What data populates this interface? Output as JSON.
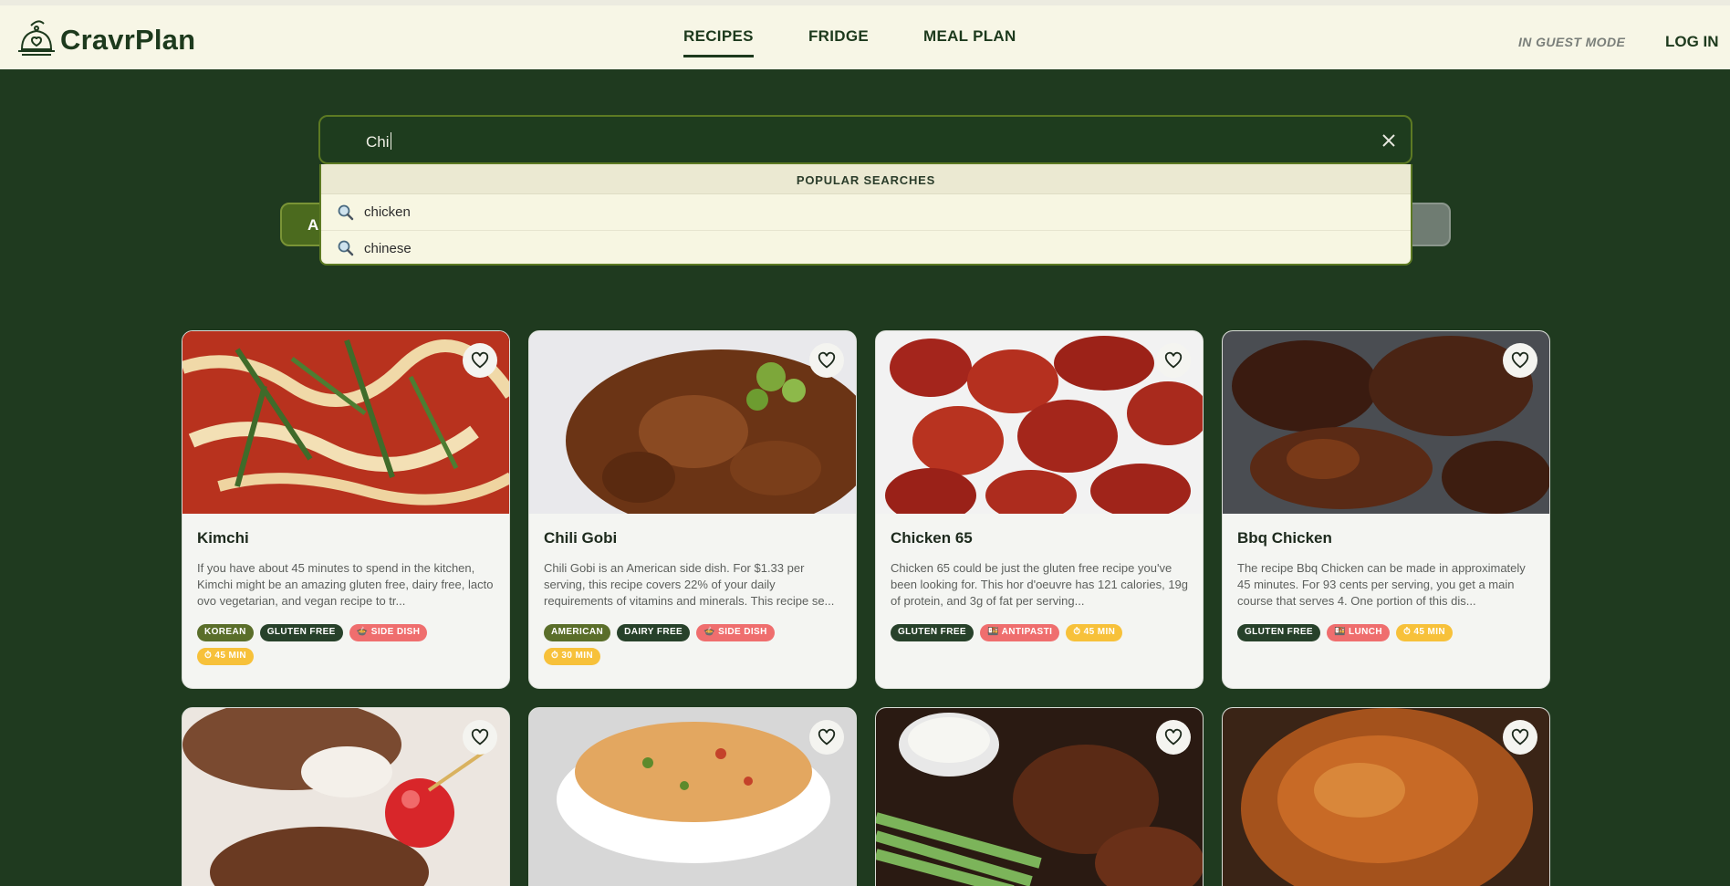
{
  "app": {
    "name": "CravrPlan"
  },
  "nav": {
    "items": [
      "RECIPES",
      "FRIDGE",
      "MEAL PLAN"
    ],
    "active": "RECIPES"
  },
  "header": {
    "guest_label": "IN GUEST MODE",
    "login_label": "LOG IN"
  },
  "search": {
    "value": "Chi",
    "dropdown_title": "POPULAR SEARCHES",
    "suggestions": [
      "chicken",
      "chinese"
    ]
  },
  "filters": {
    "left_label": "A"
  },
  "recipes": [
    {
      "title": "Kimchi",
      "description": "If you have about 45 minutes to spend in the kitchen, Kimchi might be an amazing gluten free, dairy free, lacto ovo vegetarian, and vegan recipe to tr...",
      "tags": [
        {
          "label": "KOREAN",
          "kind": "cuisine"
        },
        {
          "label": "GLUTEN FREE",
          "kind": "diet"
        },
        {
          "label": "SIDE DISH",
          "kind": "type"
        },
        {
          "label": "45 MIN",
          "kind": "time"
        }
      ]
    },
    {
      "title": "Chili Gobi",
      "description": "Chili Gobi is an American side dish. For $1.33 per serving, this recipe covers 22% of your daily requirements of vitamins and minerals. This recipe se...",
      "tags": [
        {
          "label": "AMERICAN",
          "kind": "cuisine"
        },
        {
          "label": "DAIRY FREE",
          "kind": "diet"
        },
        {
          "label": "SIDE DISH",
          "kind": "type"
        },
        {
          "label": "30 MIN",
          "kind": "time"
        }
      ]
    },
    {
      "title": "Chicken 65",
      "description": "Chicken 65 could be just the gluten free recipe you've been looking for. This hor d'oeuvre has 121 calories, 19g of protein, and 3g of fat per serving...",
      "tags": [
        {
          "label": "GLUTEN FREE",
          "kind": "diet"
        },
        {
          "label": "ANTIPASTI",
          "kind": "type"
        },
        {
          "label": "45 MIN",
          "kind": "time"
        }
      ]
    },
    {
      "title": "Bbq Chicken",
      "description": "The recipe Bbq Chicken can be made in approximately 45 minutes. For 93 cents per serving, you get a main course that serves 4. One portion of this dis...",
      "tags": [
        {
          "label": "GLUTEN FREE",
          "kind": "diet"
        },
        {
          "label": "LUNCH",
          "kind": "type"
        },
        {
          "label": "45 MIN",
          "kind": "time"
        }
      ]
    }
  ],
  "colors": {
    "brand_dark": "#1d3a1d",
    "page_bg": "#1f3a1f",
    "header_bg": "#f7f6e6",
    "cuisine_tag": "#5a6e2a",
    "diet_tag": "#27412a",
    "type_tag": "#ef6e6e",
    "time_tag": "#f7c13a"
  }
}
